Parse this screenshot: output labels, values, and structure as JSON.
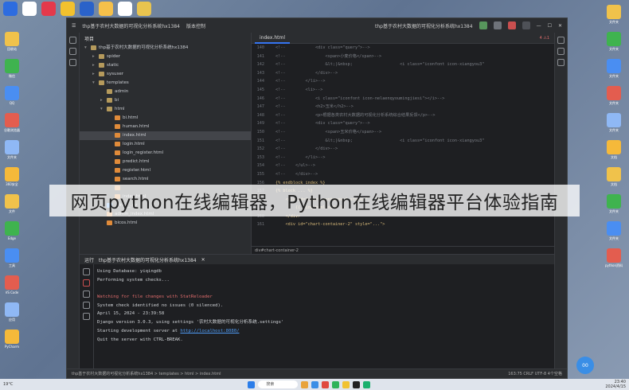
{
  "banner": {
    "text": "网页python在线编辑器，Python在线编辑器平台体验指南"
  },
  "titlebar": {
    "project_label": "项目",
    "project_name": "thp基于农村大数据的可视化分析系统hx1384",
    "version_control": "版本控制"
  },
  "project_tree": {
    "header": "项目",
    "items": [
      {
        "label": "thp基于农村大数据的可视化分析系统hx1384",
        "indent": 0,
        "type": "folder",
        "arrow": "▾"
      },
      {
        "label": "spider",
        "indent": 1,
        "type": "folder",
        "arrow": "▸"
      },
      {
        "label": "static",
        "indent": 1,
        "type": "folder",
        "arrow": "▸"
      },
      {
        "label": "sysuser",
        "indent": 1,
        "type": "folder",
        "arrow": "▸"
      },
      {
        "label": "templates",
        "indent": 1,
        "type": "folder",
        "arrow": "▾"
      },
      {
        "label": "admin",
        "indent": 2,
        "type": "folder",
        "arrow": ""
      },
      {
        "label": "bi",
        "indent": 2,
        "type": "folder",
        "arrow": "▸"
      },
      {
        "label": "html",
        "indent": 2,
        "type": "folder",
        "arrow": "▾"
      },
      {
        "label": "bi.html",
        "indent": 3,
        "type": "html",
        "arrow": ""
      },
      {
        "label": "human.html",
        "indent": 3,
        "type": "html",
        "arrow": ""
      },
      {
        "label": "index.html",
        "indent": 3,
        "type": "html",
        "arrow": "",
        "selected": true
      },
      {
        "label": "login.html",
        "indent": 3,
        "type": "html",
        "arrow": ""
      },
      {
        "label": "login_register.html",
        "indent": 3,
        "type": "html",
        "arrow": ""
      },
      {
        "label": "predict.html",
        "indent": 3,
        "type": "html",
        "arrow": ""
      },
      {
        "label": "register.html",
        "indent": 3,
        "type": "html",
        "arrow": ""
      },
      {
        "label": "search.html",
        "indent": 3,
        "type": "html",
        "arrow": ""
      },
      {
        "label": "",
        "indent": 3,
        "type": "html",
        "arrow": ""
      },
      {
        "label": "index.html",
        "indent": 3,
        "type": "html",
        "arrow": ""
      },
      {
        "label": "__init__.py",
        "indent": 2,
        "type": "py",
        "arrow": ""
      },
      {
        "label": "admin_index.html",
        "indent": 2,
        "type": "html",
        "arrow": ""
      },
      {
        "label": "bicos.html",
        "indent": 2,
        "type": "html",
        "arrow": ""
      }
    ]
  },
  "editor": {
    "tab": "index.html",
    "warnings": "4 ⚠1",
    "breadcrumb": "div#chart-container-2",
    "lines": [
      {
        "n": "140",
        "text": "<!--            <div class=\"query\">-->"
      },
      {
        "n": "141",
        "text": "<!--                <span>小麦价格</span>-->"
      },
      {
        "n": "142",
        "text": "<!--                &lt;|&nbsp;                   <i class=\"iconfont icon-xiangyou3\""
      },
      {
        "n": "143",
        "text": "<!--            </div>-->"
      },
      {
        "n": "144",
        "text": "<!--        </li>-->"
      },
      {
        "n": "145",
        "text": "<!--        <li>-->"
      },
      {
        "n": "146",
        "text": "<!--            <i class=\"iconfont icon-nelaenqyoumingjiesi\"></i>-->"
      },
      {
        "n": "147",
        "text": "<!--            <h2>玉米</h2>-->"
      },
      {
        "n": "148",
        "text": "<!--            <p>根据各类农村大数据的可视化分析系统综合结果反馈</p>-->"
      },
      {
        "n": "149",
        "text": "<!--            <div class=\"query\">-->"
      },
      {
        "n": "150",
        "text": "<!--                <span>玉米价格</span>-->"
      },
      {
        "n": "151",
        "text": "<!--                &lt;|&nbsp;                   <i class=\"iconfont icon-xiangyou3\""
      },
      {
        "n": "152",
        "text": "<!--            </div>-->"
      },
      {
        "n": "153",
        "text": "<!--        </li>-->"
      },
      {
        "n": "154",
        "text": "<!--    </ul>-->"
      },
      {
        "n": "155",
        "text": "<!--    </div>-->"
      },
      {
        "n": "156",
        "text": "{% endblock index %}"
      },
      {
        "n": "157",
        "text": "{% block ... %}"
      },
      {
        "n": "158",
        "text": "    <div id=\"chart-container\" style=\"...\">"
      },
      {
        "n": "159",
        "text": "        {{ line_html|safe }}"
      },
      {
        "n": "160",
        "text": "    </div>"
      },
      {
        "n": "161",
        "text": "    <div id=\"chart-container-2\" style=\"...\">"
      }
    ]
  },
  "run": {
    "tab_label": "运行",
    "config_name": "thp基于农村大数据的可视化分析系统hx1384",
    "output": [
      {
        "text": "Using Database:  yiqingdb",
        "style": "normal"
      },
      {
        "text": "Performing system checks...",
        "style": "normal"
      },
      {
        "text": "",
        "style": "normal"
      },
      {
        "text": "Watching for file changes with StatReloader",
        "style": "red"
      },
      {
        "text": "System check identified no issues (0 silenced).",
        "style": "normal"
      },
      {
        "text": "April 15, 2024 - 23:39:58",
        "style": "normal"
      },
      {
        "text": "Django version 3.0.3, using settings '农村大数据的可视化分析系统.settings'",
        "style": "normal"
      },
      {
        "text": "Starting development server at ",
        "style": "normal",
        "link": "http://localhost:8080/"
      },
      {
        "text": "Quit the server with CTRL-BREAK.",
        "style": "normal"
      }
    ]
  },
  "statusbar": {
    "path": "thp基于农村大数据的可视化分析系统hx1384 > templates > html > index.html",
    "right": "163:75   CRLF   UTF-8   4个空格"
  },
  "taskbar": {
    "weather": "19°C",
    "search_placeholder": "搜索",
    "time": "23:40",
    "date": "2024/4/15"
  },
  "bubble": {
    "text": "00"
  },
  "desktop_icons": {
    "left": [
      "回收站",
      "微信",
      "QQ",
      "谷歌浏览器",
      "文件夹",
      "360安全",
      "文件",
      "Edge",
      "工具",
      "VS Code",
      "应用",
      "PyCharm"
    ],
    "right": [
      "文件夹",
      "文件夹",
      "文件夹",
      "文件夹",
      "文件夹",
      "文档",
      "文档",
      "文件夹",
      "文件夹",
      "python资料"
    ]
  },
  "colors": {
    "accent": "#3574f0",
    "ide_bg": "#1e1f22",
    "panel_bg": "#2b2d30",
    "error_red": "#e06c6c",
    "link_blue": "#4f9cf5"
  }
}
